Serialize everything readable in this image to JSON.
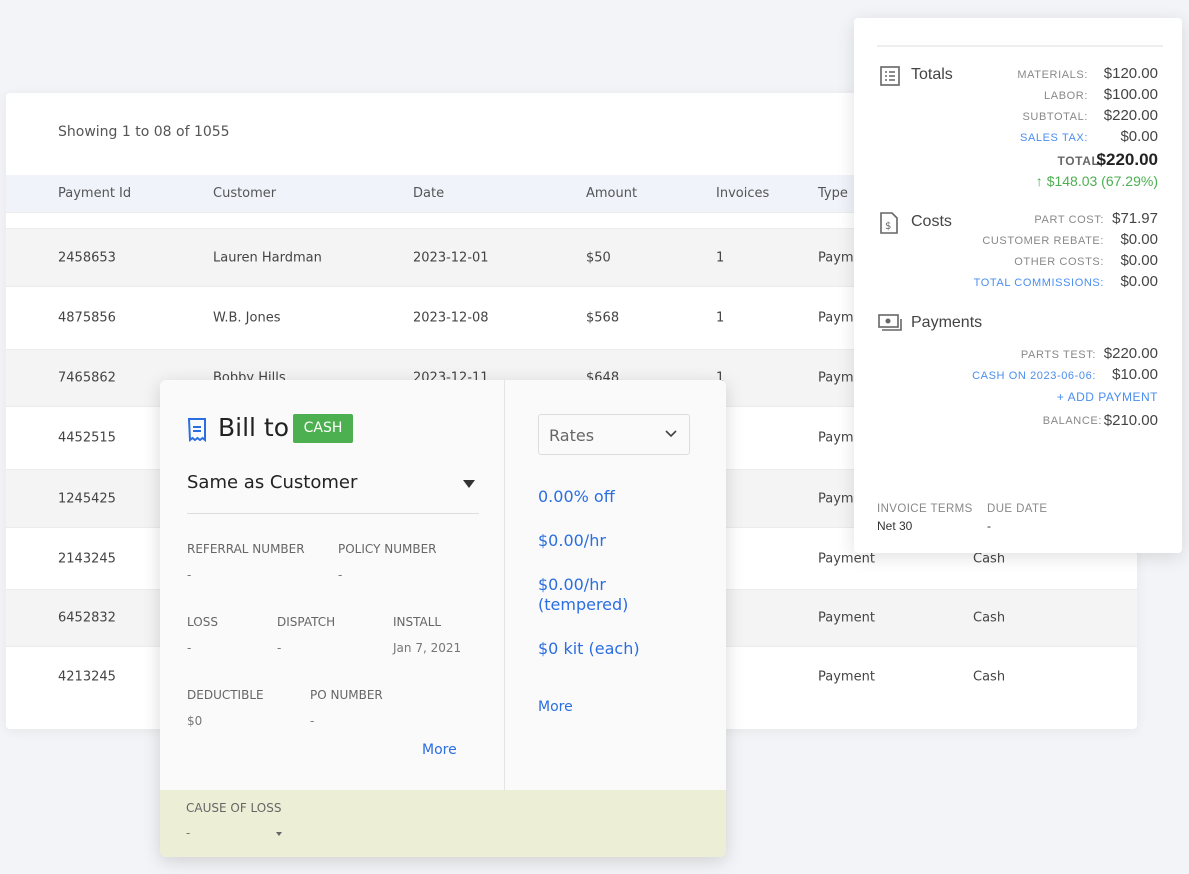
{
  "table": {
    "showing": "Showing 1 to 08 of 1055",
    "columns": [
      "Payment Id",
      "Customer",
      "Date",
      "Amount",
      "Invoices",
      "Type"
    ],
    "rows": [
      {
        "id": "2458653",
        "customer": "Lauren Hardman",
        "date": "2023-12-01",
        "amount": "$50",
        "invoices": "1",
        "type": "Payment",
        "method": ""
      },
      {
        "id": "4875856",
        "customer": "W.B. Jones",
        "date": "2023-12-08",
        "amount": "$568",
        "invoices": "1",
        "type": "Payment",
        "method": ""
      },
      {
        "id": "7465862",
        "customer": "Bobby Hills",
        "date": "2023-12-11",
        "amount": "$648",
        "invoices": "1",
        "type": "Payment",
        "method": ""
      },
      {
        "id": "4452515",
        "customer": "",
        "date": "",
        "amount": "",
        "invoices": "",
        "type": "Payment",
        "method": ""
      },
      {
        "id": "1245425",
        "customer": "",
        "date": "",
        "amount": "",
        "invoices": "",
        "type": "Payment",
        "method": ""
      },
      {
        "id": "2143245",
        "customer": "",
        "date": "",
        "amount": "",
        "invoices": "",
        "type": "Payment",
        "method": "Cash"
      },
      {
        "id": "6452832",
        "customer": "",
        "date": "",
        "amount": "",
        "invoices": "",
        "type": "Payment",
        "method": "Cash"
      },
      {
        "id": "4213245",
        "customer": "",
        "date": "",
        "amount": "",
        "invoices": "",
        "type": "Payment",
        "method": "Cash"
      }
    ]
  },
  "bill": {
    "title": "Bill to",
    "badge": "CASH",
    "badge_color": "#4caf50",
    "bill_to_select": "Same as Customer",
    "fields": [
      {
        "label": "REFERRAL NUMBER",
        "value": "-"
      },
      {
        "label": "POLICY NUMBER",
        "value": "-"
      },
      {
        "label": "LOSS",
        "value": "-"
      },
      {
        "label": "DISPATCH",
        "value": "-"
      },
      {
        "label": "INSTALL",
        "value": "Jan 7, 2021"
      },
      {
        "label": "DEDUCTIBLE",
        "value": "$0"
      },
      {
        "label": "PO NUMBER",
        "value": "-"
      }
    ],
    "more": "More",
    "rates_select": "Rates",
    "rates": [
      "0.00% off",
      "$0.00/hr",
      "$0.00/hr (tempered)",
      "$0 kit (each)"
    ],
    "rates_more": "More",
    "cause_label": "CAUSE OF LOSS",
    "cause_value": "-"
  },
  "summary": {
    "totals_title": "Totals",
    "totals": [
      {
        "label": "MATERIALS:",
        "value": "$120.00"
      },
      {
        "label": "LABOR:",
        "value": "$100.00"
      },
      {
        "label": "SUBTOTAL:",
        "value": "$220.00"
      },
      {
        "label": "SALES TAX:",
        "value": "$0.00",
        "link": true
      }
    ],
    "total_label": "TOTAL:",
    "total_value": "$220.00",
    "profit": "$148.03 (67.29%)",
    "profit_color": "#4caf50",
    "costs_title": "Costs",
    "costs": [
      {
        "label": "PART COST:",
        "value": "$71.97"
      },
      {
        "label": "CUSTOMER REBATE:",
        "value": "$0.00"
      },
      {
        "label": "OTHER COSTS:",
        "value": "$0.00"
      },
      {
        "label": "TOTAL COMMISSIONS:",
        "value": "$0.00",
        "link": true
      }
    ],
    "payments_title": "Payments",
    "payments": [
      {
        "label": "PARTS TEST:",
        "value": "$220.00"
      },
      {
        "label": "CASH ON 2023-06-06:",
        "value": "$10.00",
        "link": true
      }
    ],
    "add_payment": "ADD PAYMENT",
    "balance_label": "BALANCE:",
    "balance_value": "$210.00",
    "invoice_terms_label": "INVOICE TERMS",
    "invoice_terms": "Net 30",
    "due_date_label": "DUE DATE",
    "due_date": "-"
  }
}
